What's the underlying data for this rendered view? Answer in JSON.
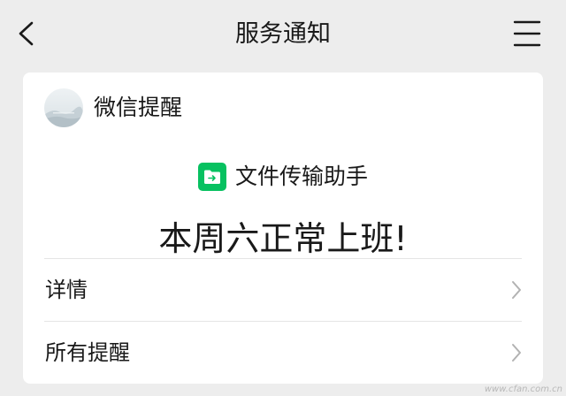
{
  "nav": {
    "title": "服务通知",
    "back_icon": "chevron-left-icon",
    "menu_icon": "hamburger-menu-icon"
  },
  "card": {
    "sender_name": "微信提醒",
    "avatar_icon": "landscape-avatar",
    "app_name": "文件传输助手",
    "app_icon": "folder-transfer-icon",
    "app_icon_color": "#07c160",
    "message": "本周六正常上班!",
    "rows": [
      {
        "label": "详情",
        "icon": "chevron-right-icon"
      },
      {
        "label": "所有提醒",
        "icon": "chevron-right-icon"
      }
    ]
  },
  "watermark": "www.cfan.com.cn",
  "colors": {
    "page_background": "#ededed",
    "card_background": "#ffffff",
    "text": "#191919",
    "chevron": "#b2b2b2",
    "divider": "#e5e5e5"
  }
}
